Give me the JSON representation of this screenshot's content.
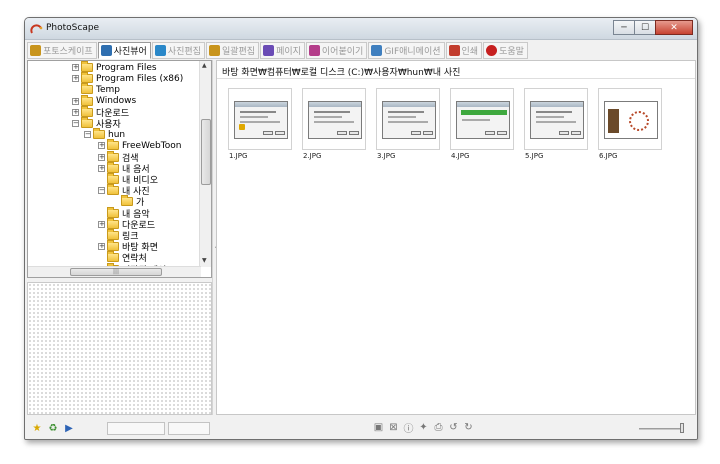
{
  "window": {
    "title": "PhotoScape",
    "controls": {
      "minimize": "─",
      "maximize": "☐",
      "close": "✕"
    }
  },
  "tabs": [
    {
      "label": "포토스케이프",
      "icon": "photoscape-home-icon",
      "active": false
    },
    {
      "label": "사진뷰어",
      "icon": "viewer-icon",
      "active": true
    },
    {
      "label": "사진편집",
      "icon": "editor-icon",
      "active": false
    },
    {
      "label": "일괄편집",
      "icon": "batch-editor-icon",
      "active": false
    },
    {
      "label": "페이지",
      "icon": "page-icon",
      "active": false
    },
    {
      "label": "이어붙이기",
      "icon": "combine-icon",
      "active": false
    },
    {
      "label": "GIF애니메이션",
      "icon": "gif-animation-icon",
      "active": false
    },
    {
      "label": "인쇄",
      "icon": "print-icon",
      "active": false
    },
    {
      "label": "도움말",
      "icon": "help-icon",
      "active": false
    }
  ],
  "tree": {
    "nodes": [
      {
        "label": "Program Files",
        "level": 0,
        "expander": "+"
      },
      {
        "label": "Program Files (x86)",
        "level": 0,
        "expander": "+"
      },
      {
        "label": "Temp",
        "level": 0,
        "expander": ""
      },
      {
        "label": "Windows",
        "level": 0,
        "expander": "+"
      },
      {
        "label": "다운로드",
        "level": 0,
        "expander": "+"
      },
      {
        "label": "사용자",
        "level": 0,
        "expander": "−"
      },
      {
        "label": "hun",
        "level": 1,
        "expander": "−"
      },
      {
        "label": "FreeWebToon",
        "level": 2,
        "expander": "+"
      },
      {
        "label": "검색",
        "level": 2,
        "expander": "+"
      },
      {
        "label": "내 음서",
        "level": 2,
        "expander": "+"
      },
      {
        "label": "내 비디오",
        "level": 2,
        "expander": ""
      },
      {
        "label": "내 사진",
        "level": 2,
        "expander": "−"
      },
      {
        "label": "가",
        "level": 3,
        "expander": ""
      },
      {
        "label": "내 음악",
        "level": 2,
        "expander": ""
      },
      {
        "label": "다운로드",
        "level": 2,
        "expander": "+"
      },
      {
        "label": "링크",
        "level": 2,
        "expander": ""
      },
      {
        "label": "바탕 화면",
        "level": 2,
        "expander": "+"
      },
      {
        "label": "연락처",
        "level": 2,
        "expander": ""
      },
      {
        "label": "저장된 게임",
        "level": 2,
        "expander": ""
      }
    ],
    "scroll_up": "▲",
    "scroll_down": "▼",
    "hscroll_grip": "|||",
    "collapse_arrow": "◀"
  },
  "main": {
    "path": "바탕 화면₩컴퓨터₩로컬 디스크 (C:)₩사용자₩hun₩내 사진",
    "thumbnails": [
      {
        "name": "1.JPG",
        "kind": "dialog"
      },
      {
        "name": "2.JPG",
        "kind": "dialog"
      },
      {
        "name": "3.JPG",
        "kind": "dialog"
      },
      {
        "name": "4.JPG",
        "kind": "progress"
      },
      {
        "name": "5.JPG",
        "kind": "dialog"
      },
      {
        "name": "6.JPG",
        "kind": "photoscape"
      }
    ]
  },
  "bottom": {
    "left_icons": [
      "star-icon",
      "recycle-icon",
      "slideshow-icon"
    ],
    "tools": [
      {
        "name": "fullscreen-icon",
        "glyph": "▣"
      },
      {
        "name": "fit-icon",
        "glyph": "⊠"
      },
      {
        "name": "info-icon",
        "glyph": "ⓘ"
      },
      {
        "name": "delete-icon",
        "glyph": "✦"
      },
      {
        "name": "print-icon",
        "glyph": "⎙"
      },
      {
        "name": "rotate-left-icon",
        "glyph": "↺"
      },
      {
        "name": "rotate-right-icon",
        "glyph": "↻"
      }
    ]
  }
}
